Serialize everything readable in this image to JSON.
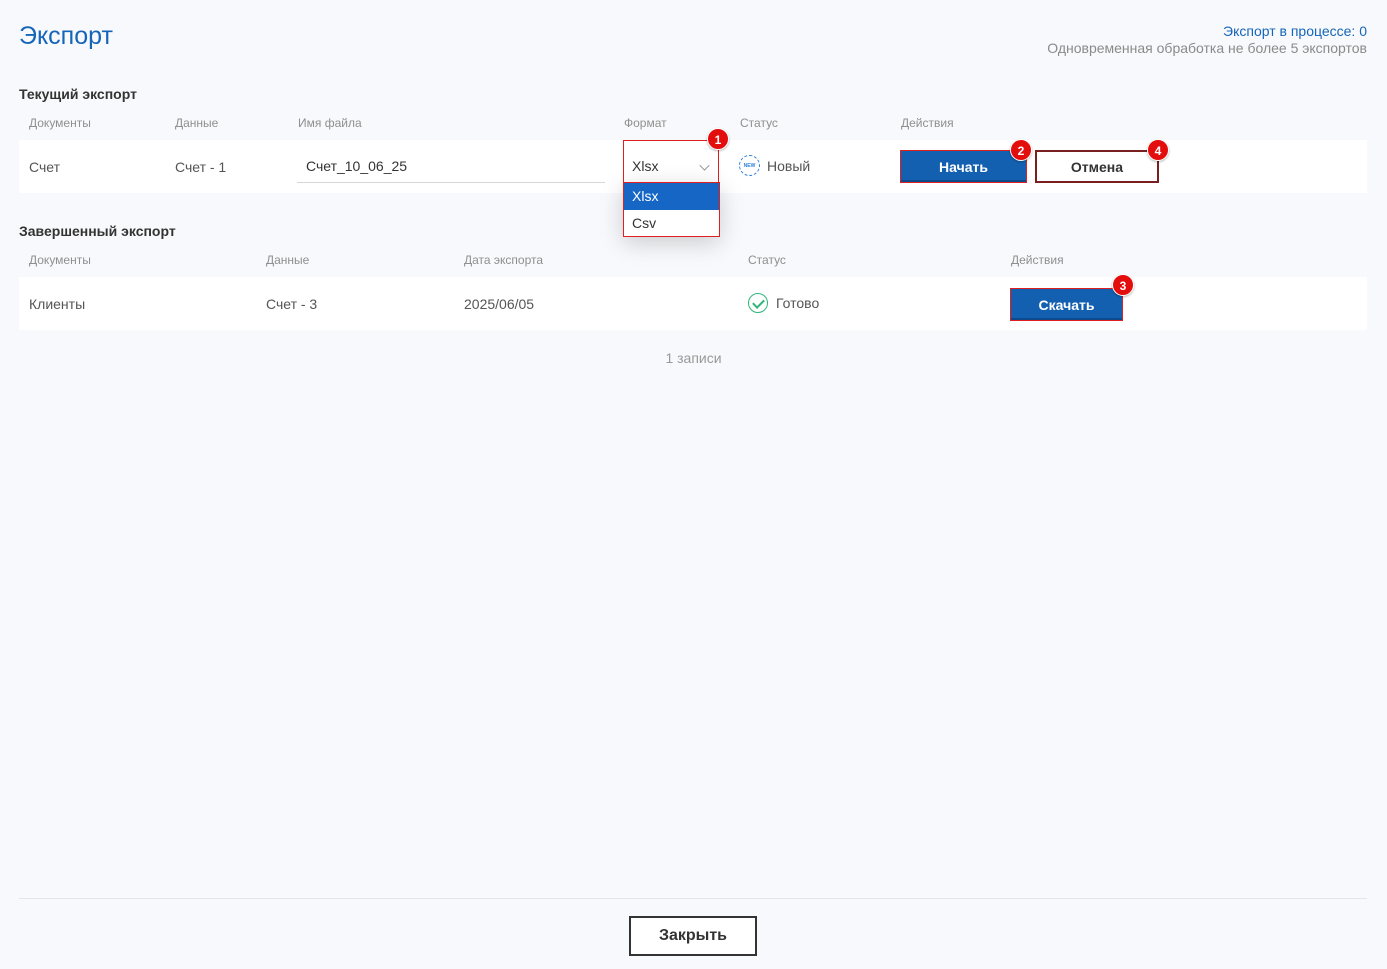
{
  "header": {
    "title": "Экспорт",
    "in_progress": "Экспорт в процессе: 0",
    "limit_note": "Одновременная обработка не более 5 экспортов"
  },
  "current_export": {
    "section_title": "Текущий экспорт",
    "columns": [
      "Документы",
      "Данные",
      "Имя файла",
      "Формат",
      "Статус",
      "Действия"
    ],
    "row": {
      "document": "Счет",
      "data": "Счет - 1",
      "filename": "Счет_10_06_25",
      "format": "Xlsx",
      "status_icon_text": "NEW",
      "status": "Новый",
      "start_label": "Начать",
      "cancel_label": "Отмена"
    },
    "format_options": [
      "Xlsx",
      "Csv"
    ]
  },
  "completed_export": {
    "section_title": "Завершенный экспорт",
    "columns": [
      "Документы",
      "Данные",
      "Дата экспорта",
      "Статус",
      "Действия"
    ],
    "row": {
      "document": "Клиенты",
      "data": "Счет - 3",
      "date": "2025/06/05",
      "status": "Готово",
      "download_label": "Скачать"
    },
    "record_count": "1 записи"
  },
  "badges": [
    "1",
    "2",
    "3",
    "4"
  ],
  "footer": {
    "close_label": "Закрыть"
  },
  "colors": {
    "accent": "#1565b8",
    "primary_button": "#1460b0",
    "highlight": "#e02020",
    "success": "#2fb57a"
  }
}
